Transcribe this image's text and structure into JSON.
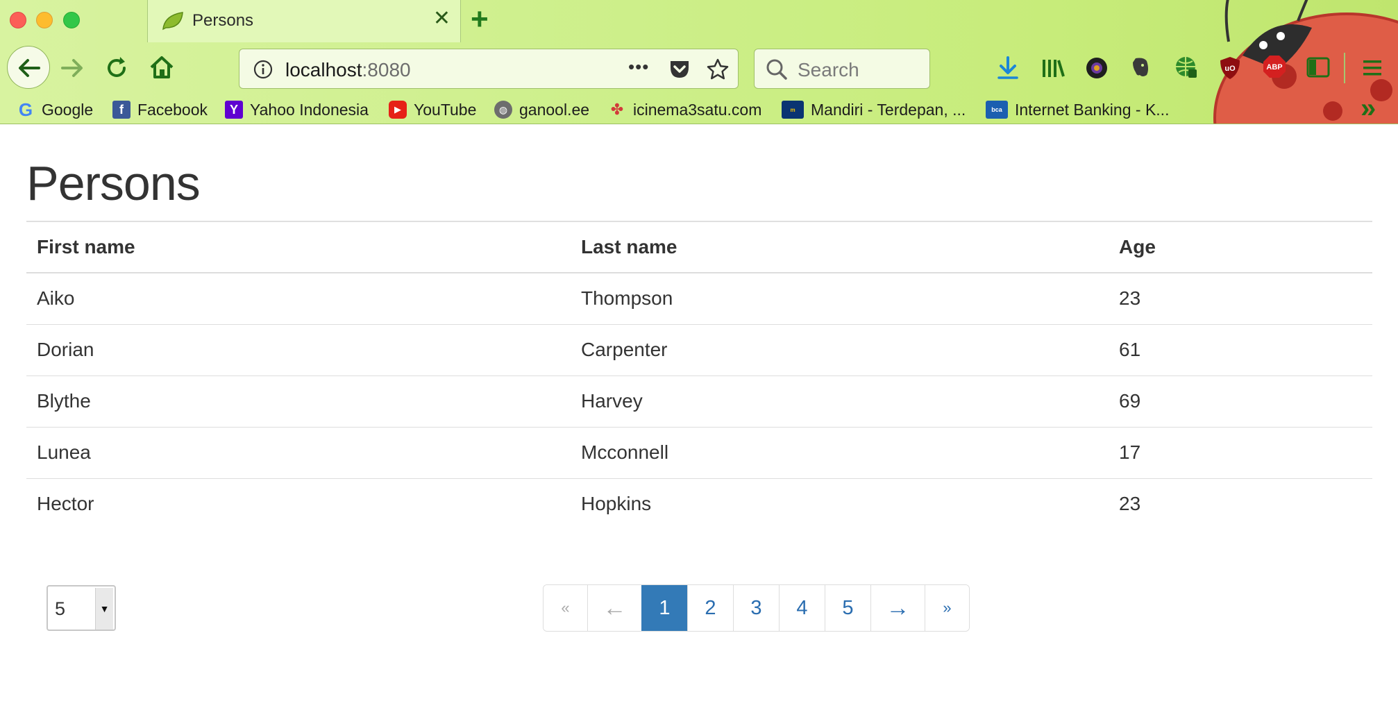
{
  "browser": {
    "tab_title": "Persons",
    "tab_close": "✕",
    "new_tab": "+",
    "url_host": "localhost",
    "url_port": ":8080",
    "page_actions": "•••",
    "search_placeholder": "Search",
    "bookmarks": [
      {
        "label": "Google",
        "icon": "google-icon"
      },
      {
        "label": "Facebook",
        "icon": "facebook-icon"
      },
      {
        "label": "Yahoo Indonesia",
        "icon": "yahoo-icon"
      },
      {
        "label": "YouTube",
        "icon": "youtube-icon"
      },
      {
        "label": "ganool.ee",
        "icon": "globe-icon"
      },
      {
        "label": "icinema3satu.com",
        "icon": "cinema-icon"
      },
      {
        "label": "Mandiri - Terdepan, ...",
        "icon": "mandiri-icon"
      },
      {
        "label": "Internet Banking - K...",
        "icon": "bca-icon"
      }
    ],
    "toolbar_icons": [
      "download-icon",
      "library-icon",
      "camera-extension-icon",
      "evernote-icon",
      "globe-extension-icon",
      "ublock-icon",
      "adblock-plus-icon",
      "sidebar-icon",
      "menu-icon"
    ],
    "ublock_label": "uO",
    "abp_label": "ABP",
    "overflow_chevron": "»",
    "colors": {
      "chrome_green": "#cdef8a",
      "accent_green": "#217a1c"
    }
  },
  "page": {
    "title": "Persons",
    "table": {
      "headers": [
        "First name",
        "Last name",
        "Age"
      ],
      "rows": [
        [
          "Aiko",
          "Thompson",
          "23"
        ],
        [
          "Dorian",
          "Carpenter",
          "61"
        ],
        [
          "Blythe",
          "Harvey",
          "69"
        ],
        [
          "Lunea",
          "Mcconnell",
          "17"
        ],
        [
          "Hector",
          "Hopkins",
          "23"
        ]
      ]
    },
    "page_size": {
      "selected": "5"
    },
    "pagination": {
      "first": "«",
      "prev": "←",
      "pages": [
        "1",
        "2",
        "3",
        "4",
        "5"
      ],
      "active_page": "1",
      "next": "→",
      "last": "»"
    },
    "colors": {
      "active_page": "#337ab7",
      "link": "#2a6db0"
    }
  }
}
